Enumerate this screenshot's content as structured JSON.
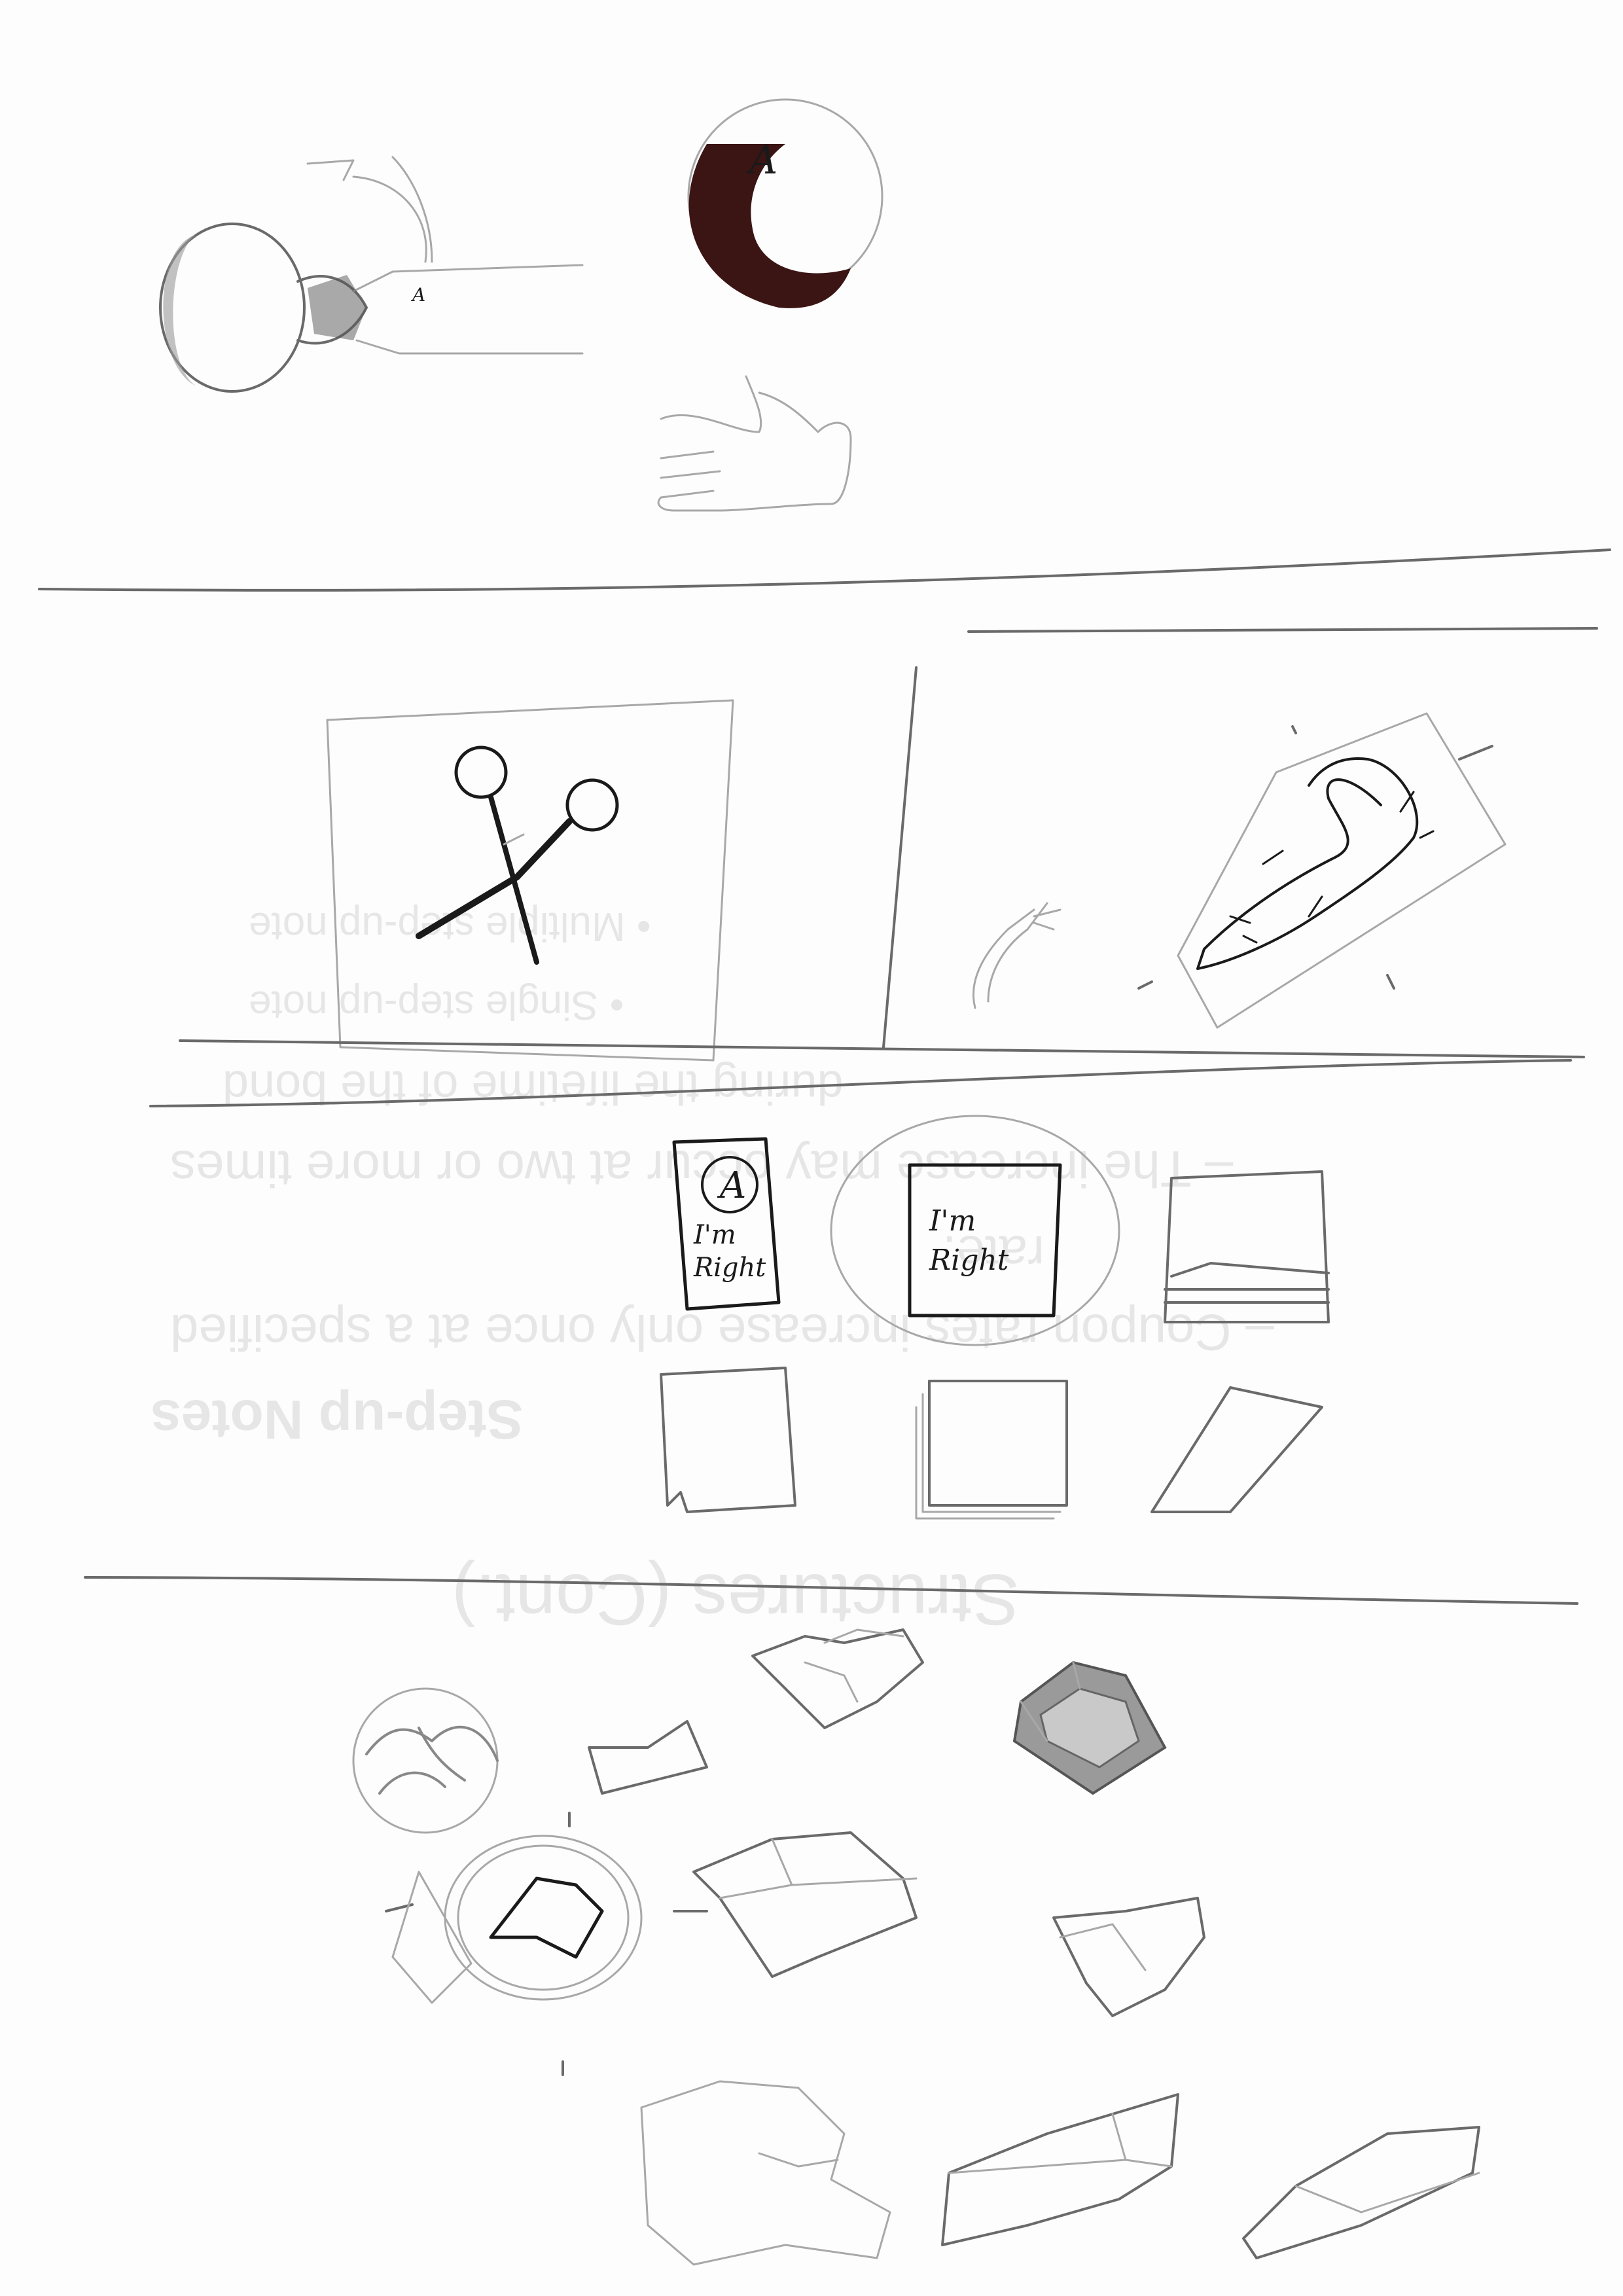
{
  "page": {
    "kind": "storyboard-sketch-sheet",
    "paper_color": "#fdfdfd",
    "pencil_color": "#6a6a6a",
    "ink_color": "#1a1a1a",
    "marker_fill": "#3b1414"
  },
  "bleed_through_text": {
    "title": "Structures (Cont.)",
    "bullet_1": "Step-up Notes",
    "line_1": "– Coupon rates increase only once at a specified",
    "line_2": "rate.",
    "line_3": "– The increase may occur at two or more times",
    "line_4": "during the lifetime of the bond",
    "sub_1": "• Single step-up note",
    "sub_2": "• Multiple step-up note"
  },
  "handwriting": {
    "ball_letter": "A",
    "cup_letter": "A",
    "card_small_line1": "I'm",
    "card_small_line2": "Right",
    "card_small_mark": "A",
    "card_large_line1": "I'm",
    "card_large_line2": "Right"
  },
  "panels": [
    {
      "name": "panel-1",
      "content": "cup, ball, hand"
    },
    {
      "name": "panel-2",
      "content": "scissors"
    },
    {
      "name": "panel-3",
      "content": "creature, hand"
    },
    {
      "name": "panel-4",
      "content": "cards, papers"
    },
    {
      "name": "panel-5",
      "content": "rocks, gem"
    }
  ]
}
